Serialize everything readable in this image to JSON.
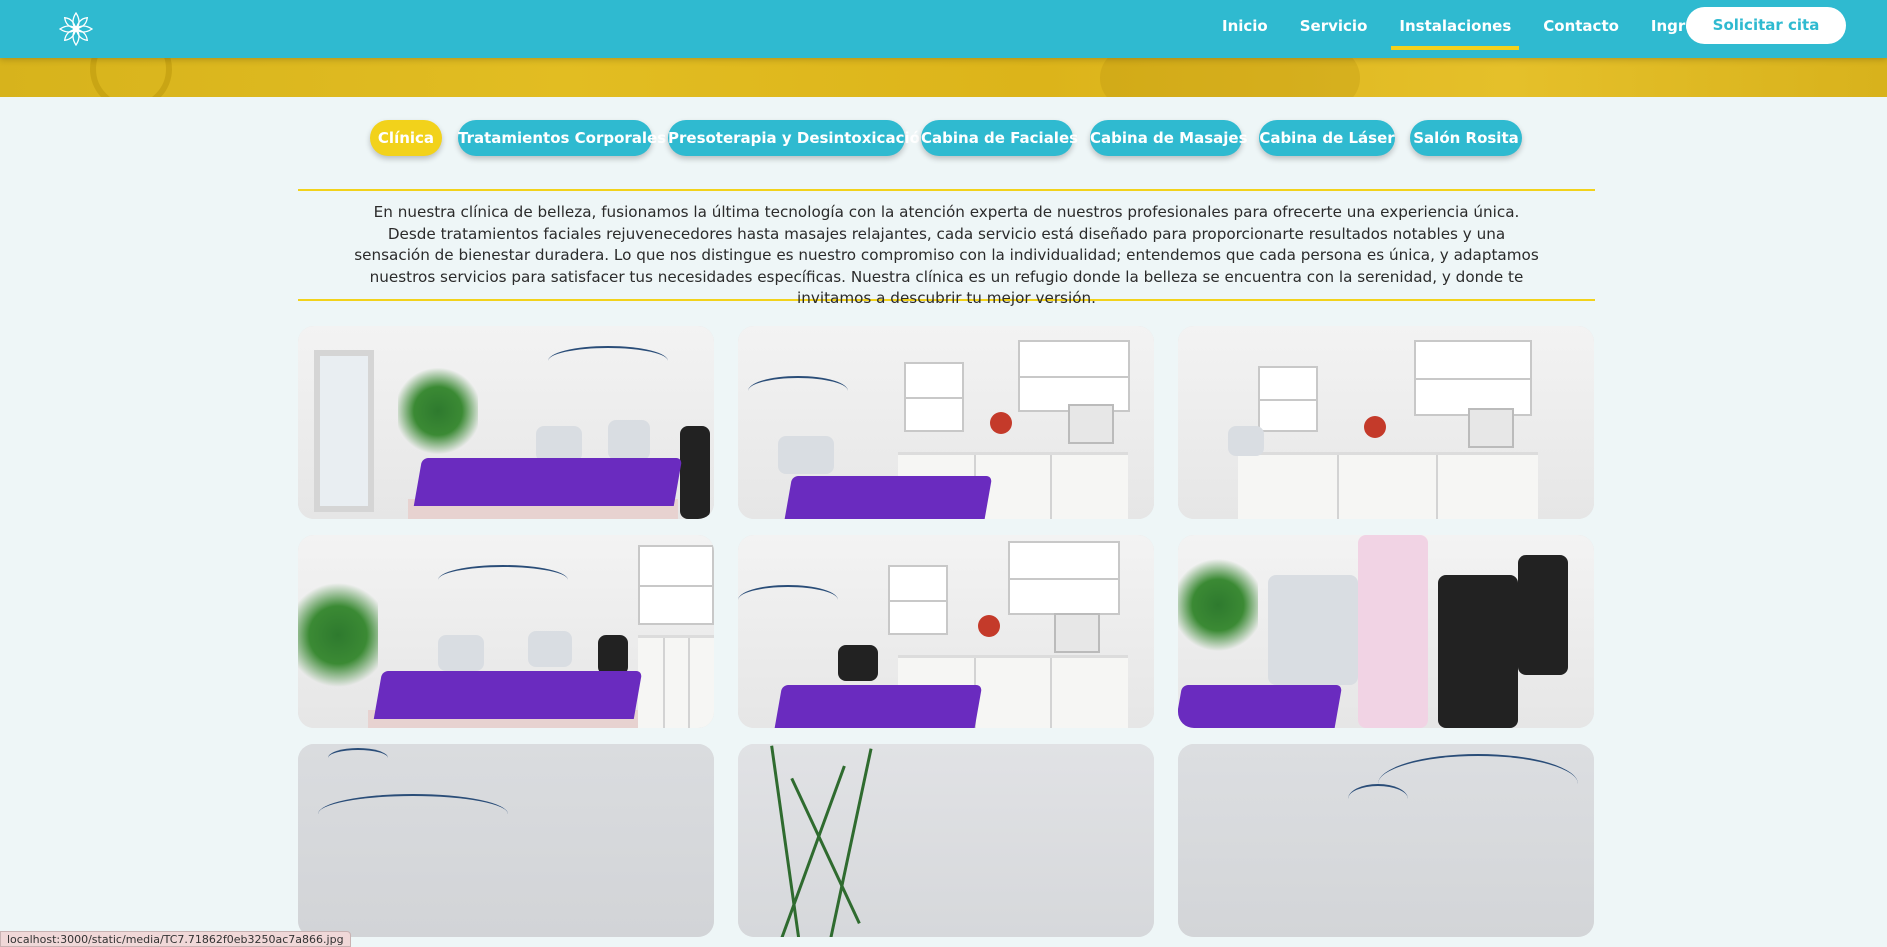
{
  "header": {
    "logo_icon": "lotus-logo-icon",
    "nav": [
      {
        "label": "Inicio",
        "active": false
      },
      {
        "label": "Servicio",
        "active": false
      },
      {
        "label": "Instalaciones",
        "active": true
      },
      {
        "label": "Contacto",
        "active": false
      },
      {
        "label": "Ingresar",
        "active": false
      }
    ],
    "cta_label": "Solicitar cita"
  },
  "tabs": [
    {
      "label": "Clínica",
      "active": true
    },
    {
      "label": "Tratamientos Corporales",
      "active": false
    },
    {
      "label": "Presoterapia y Desintoxicación",
      "active": false
    },
    {
      "label": "Cabina de Faciales",
      "active": false
    },
    {
      "label": "Cabina de Masajes",
      "active": false
    },
    {
      "label": "Cabina de Láser",
      "active": false
    },
    {
      "label": "Salón Rosita",
      "active": false
    }
  ],
  "intro": {
    "text": "En nuestra clínica de belleza, fusionamos la última tecnología con la atención experta de nuestros profesionales para ofrecerte una experiencia única. Desde tratamientos faciales rejuvenecedores hasta masajes relajantes, cada servicio está diseñado para proporcionarte resultados notables y una sensación de bienestar duradera. Lo que nos distingue es nuestro compromiso con la individualidad; entendemos que cada persona es única, y adaptamos nuestros servicios para satisfacer tus necesidades específicas. Nuestra clínica es un refugio donde la belleza se encuentra con la serenidad, y donde te invitamos a descubrir tu mejor versión."
  },
  "gallery": {
    "photos": [
      "clinic-room-photo-1",
      "clinic-room-photo-2",
      "clinic-room-photo-3",
      "clinic-room-photo-4",
      "clinic-room-photo-5",
      "clinic-room-photo-6",
      "clinic-room-photo-7",
      "clinic-room-photo-8",
      "clinic-room-photo-9"
    ]
  },
  "status_bar": {
    "url": "localhost:3000/static/media/TC7.71862f0eb3250ac7a866.jpg"
  },
  "colors": {
    "primary": "#2fbad0",
    "accent": "#f2d21b",
    "background": "#eef6f7",
    "text": "#2b2b2b"
  }
}
